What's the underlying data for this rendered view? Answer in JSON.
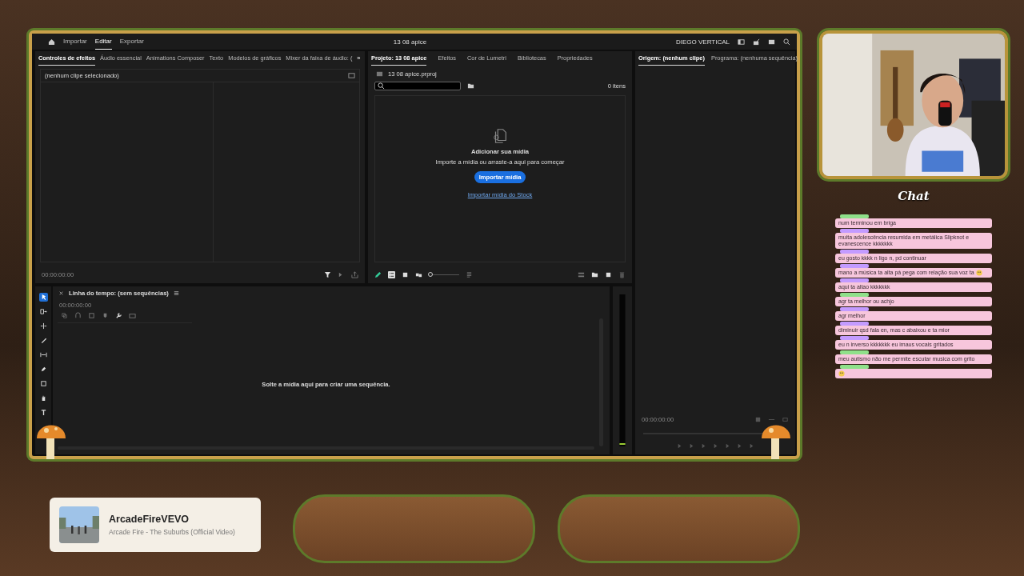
{
  "app": {
    "nav": [
      {
        "label": "Importar",
        "selected": false
      },
      {
        "label": "Editar",
        "selected": true
      },
      {
        "label": "Exportar",
        "selected": false
      }
    ],
    "title": "13 08 apice",
    "workspace": "DIEGO VERTICAL",
    "left_panel": {
      "tabs": [
        {
          "label": "Controles de efeitos",
          "selected": true
        },
        {
          "label": "Áudio essencial",
          "selected": false
        },
        {
          "label": "Animations Composer",
          "selected": false
        },
        {
          "label": "Texto",
          "selected": false
        },
        {
          "label": "Modelos de gráficos",
          "selected": false
        },
        {
          "label": "Mixer da faixa de áudio: (",
          "selected": false
        }
      ],
      "more": "»",
      "header": "(nenhum clipe selecionado)",
      "timecode": "00:00:00:00"
    },
    "project_panel": {
      "tabs": [
        {
          "label": "Projeto: 13 08 apice",
          "selected": true
        },
        {
          "label": "Efeitos",
          "selected": false
        },
        {
          "label": "Cor de Lumetri",
          "selected": false
        },
        {
          "label": "Bibliotecas",
          "selected": false
        },
        {
          "label": "Propriedades",
          "selected": false
        }
      ],
      "file": "13 08 apice.prproj",
      "count": "0 itens",
      "empty_title": "Adicionar sua mídia",
      "empty_text": "Importe a mídia ou arraste-a aqui para começar",
      "import_button": "Importar mídia",
      "stock_link": "Importar mídia do Stock",
      "zoom_slider": {
        "level": 0
      }
    },
    "monitor_panel": {
      "tabs": [
        {
          "label": "Origem: (nenhum clipe)",
          "selected": true
        },
        {
          "label": "Programa: (nenhuma sequência)",
          "selected": false
        }
      ],
      "timecode": "00:00:00:00"
    },
    "timeline": {
      "title": "Linha do tempo: (sem sequências)",
      "timecode": "00:00:00:00",
      "drop_text": "Solte a mídia aqui para criar uma sequência.",
      "tools": [
        {
          "kind": "select",
          "selected": true
        },
        {
          "kind": "track",
          "selected": false
        },
        {
          "kind": "ripple",
          "selected": false
        },
        {
          "kind": "razor",
          "selected": false
        },
        {
          "kind": "slip",
          "selected": false
        },
        {
          "kind": "pen",
          "selected": false
        },
        {
          "kind": "rect",
          "selected": false
        },
        {
          "kind": "hand",
          "selected": false
        },
        {
          "kind": "type",
          "selected": false
        }
      ]
    }
  },
  "chat": {
    "title": "Chat",
    "messages": [
      {
        "text": "num terminou em briga",
        "color": "#8fe08a",
        "emote": false
      },
      {
        "text": "muita adolescência resumida em metálica Slipknot e evanescence kkkkkkk",
        "color": "#c39bff",
        "emote": false
      },
      {
        "text": "eu gosto kkkk n ligo n, pd continuar",
        "color": "#c39bff",
        "emote": false
      },
      {
        "text": "mano a música ta alta pá pega com relação sua voz ta",
        "color": "#c39bff",
        "emote": true
      },
      {
        "text": "aqui ta altao kkkkkkk",
        "color": "#c39bff",
        "emote": false
      },
      {
        "text": "agr ta melhor ou achjo",
        "color": "#8fe08a",
        "emote": false
      },
      {
        "text": "agr melhor",
        "color": "#c39bff",
        "emote": false
      },
      {
        "text": "diminuir qsd fala en, mas c abaixou e ta mior",
        "color": "#c39bff",
        "emote": false
      },
      {
        "text": "eu n inverso kkkkkkk eu imaus vocais gritados",
        "color": "#c39bff",
        "emote": false
      },
      {
        "text": "meu autismo não me permite escutar musica com grito",
        "color": "#8fe08a",
        "emote": false
      },
      {
        "color": "#8fe08a",
        "emote": true
      }
    ]
  },
  "now_playing": {
    "channel": "ArcadeFireVEVO",
    "title": "Arcade Fire - The Suburbs (Official Video)"
  }
}
